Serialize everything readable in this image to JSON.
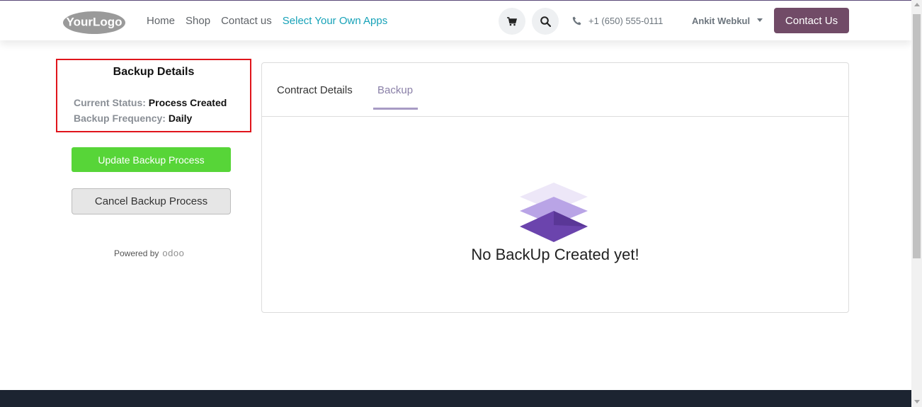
{
  "header": {
    "logo_text": "YourLogo",
    "nav": [
      "Home",
      "Shop",
      "Contact us",
      "Select Your Own Apps"
    ],
    "phone": "+1 (650) 555-0111",
    "user": "Ankit Webkul",
    "contact_button": "Contact Us",
    "accent_color": "#714b67"
  },
  "sidebar": {
    "title": "Backup Details",
    "status_label": "Current Status:",
    "status_value": "Process Created",
    "frequency_label": "Backup Frequency:",
    "frequency_value": "Daily",
    "update_button": "Update Backup Process",
    "cancel_button": "Cancel Backup Process",
    "powered_by": "Powered by",
    "powered_brand": "odoo"
  },
  "main": {
    "tabs": [
      "Contract Details",
      "Backup"
    ],
    "active_tab": "Backup",
    "empty_message": "No BackUp Created yet!"
  },
  "icons": [
    "logo",
    "cart-icon",
    "search-icon",
    "phone-icon",
    "chevron-down-icon",
    "layers-icon"
  ]
}
